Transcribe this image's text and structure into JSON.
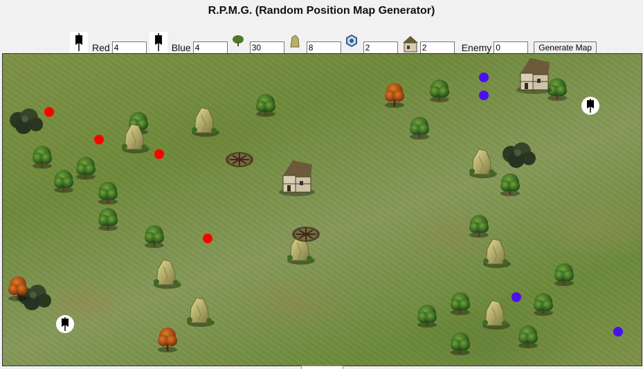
{
  "title": "R.P.M.G. (Random Position Map Generator)",
  "controls": {
    "red_label": "Red",
    "red_value": "4",
    "blue_label": "Blue",
    "blue_value": "4",
    "trees_value": "30",
    "rocks_value": "8",
    "ruins_value": "2",
    "houses_value": "2",
    "enemy_label": "Enemy",
    "enemy_value": "0",
    "generate_label": "Generate Map",
    "icons": [
      "banner-icon",
      "banner-icon",
      "tree-icon",
      "rock-icon",
      "ring-icon",
      "house-icon"
    ]
  },
  "colors": {
    "red_team": "#ff0000",
    "blue_team": "#4a10f0"
  }
}
